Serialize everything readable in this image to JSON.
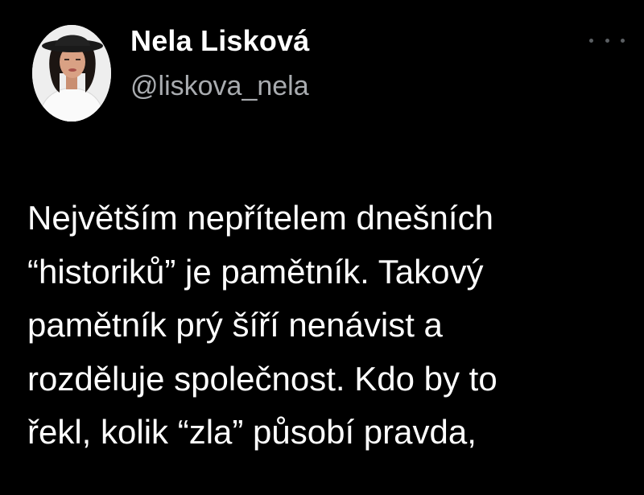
{
  "tweet": {
    "author": {
      "display_name": "Nela Lisková",
      "handle": "@liskova_nela",
      "avatar": "profile-photo"
    },
    "more_icon": "more-horizontal-icon",
    "text_lines": [
      "Největším nepřítelem dnešních",
      "“historiků” je pamětník. Takový",
      "pamětník prý šíří nenávist a",
      "rozděluje společnost. Kdo by to",
      "řekl, kolik “zla” působí pravda,"
    ]
  },
  "colors": {
    "background": "#000000",
    "text": "#ffffff",
    "secondary_text": "#a9acb0"
  }
}
